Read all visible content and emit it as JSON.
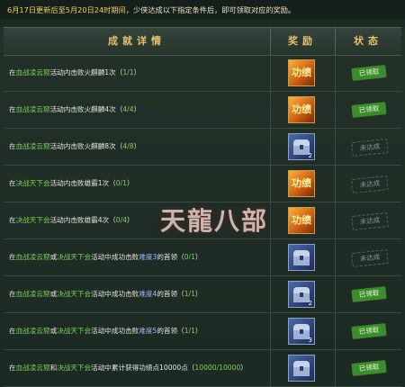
{
  "notice": {
    "date_start": "6月17日更新后至5月20日24时期间",
    "text": "，少侠达成以下指定条件后，即可领取对应的奖励。"
  },
  "header": {
    "detail": "成就详情",
    "reward": "奖励",
    "status": "状态"
  },
  "rows": [
    {
      "prefix": "在",
      "act": "血战凌云窟",
      "mid": "活动内击败火麒麟1次（",
      "lvl": "",
      "prog": "1/1",
      "suffix": "）",
      "reward": "merit",
      "qty": "",
      "status": "已领取",
      "status_type": "done"
    },
    {
      "prefix": "在",
      "act": "血战凌云窟",
      "mid": "活动内击败火麒麟4次（",
      "lvl": "",
      "prog": "4/4",
      "suffix": "）",
      "reward": "merit",
      "qty": "",
      "status": "已领取",
      "status_type": "done"
    },
    {
      "prefix": "在",
      "act": "血战凌云窟",
      "mid": "活动内击败火麒麟8次（",
      "lvl": "",
      "prog": "4/8",
      "suffix": "）",
      "reward": "chest",
      "qty": "2",
      "status": "未达成",
      "status_type": "todo"
    },
    {
      "prefix": "在",
      "act": "决战天下会",
      "mid": "活动内击败雄霸1次（",
      "lvl": "",
      "prog": "0/1",
      "suffix": "）",
      "reward": "merit",
      "qty": "",
      "status": "未达成",
      "status_type": "todo"
    },
    {
      "prefix": "在",
      "act": "决战天下会",
      "mid": "活动内击败雄霸4次（",
      "lvl": "",
      "prog": "0/4",
      "suffix": "）",
      "reward": "merit",
      "qty": "",
      "status": "未达成",
      "status_type": "todo"
    },
    {
      "prefix": "在",
      "act": "血战凌云窟",
      "mid2": "或",
      "act2": "决战天下会",
      "mid": "活动中成功击败",
      "lvl": "难度3",
      "tail": "的首领（",
      "prog": "0/1",
      "suffix": "）",
      "reward": "chest",
      "qty": "",
      "status": "未达成",
      "status_type": "todo"
    },
    {
      "prefix": "在",
      "act": "血战凌云窟",
      "mid2": "或",
      "act2": "决战天下会",
      "mid": "活动中成功击败",
      "lvl": "难度4",
      "tail": "的首领（",
      "prog": "1/1",
      "suffix": "）",
      "reward": "chest",
      "qty": "2",
      "status": "已领取",
      "status_type": "done"
    },
    {
      "prefix": "在",
      "act": "血战凌云窟",
      "mid2": "或",
      "act2": "决战天下会",
      "mid": "活动中成功击败",
      "lvl": "难度5",
      "tail": "的首领（",
      "prog": "1/1",
      "suffix": "）",
      "reward": "chest",
      "qty": "3",
      "status": "已领取",
      "status_type": "done"
    },
    {
      "prefix": "在",
      "act": "血战凌云窟",
      "mid2": "和",
      "act2": "决战天下会",
      "mid": "活动中累计获得功绩点10000点（",
      "lvl": "",
      "prog": "10000/10000",
      "suffix": "）",
      "reward": "chest",
      "qty": "",
      "status": "已领取",
      "status_type": "done"
    }
  ],
  "reward_glyph": "功绩",
  "watermark": "天龍八部"
}
